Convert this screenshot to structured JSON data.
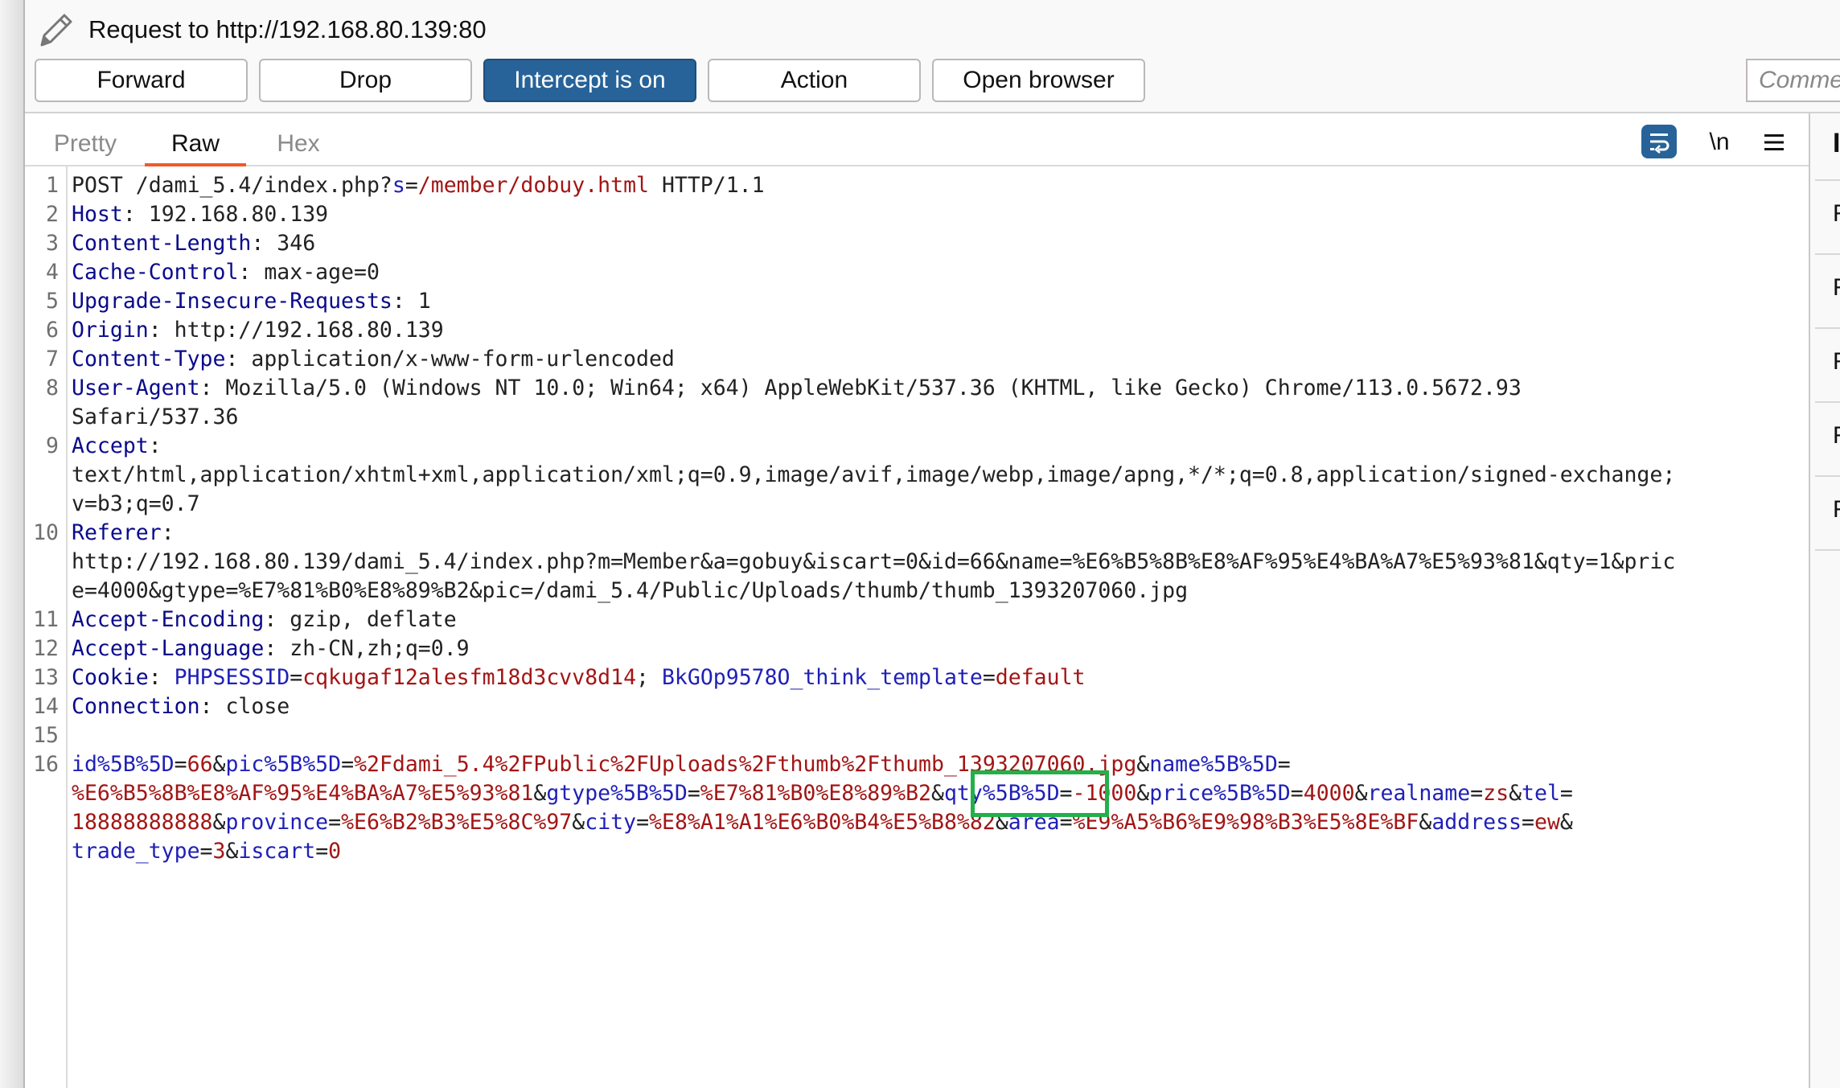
{
  "header": {
    "icon": "pencil-icon",
    "title": "Request to http://192.168.80.139:80"
  },
  "toolbar": {
    "forward_label": "Forward",
    "drop_label": "Drop",
    "intercept_label": "Intercept is on",
    "action_label": "Action",
    "open_browser_label": "Open browser",
    "comment_placeholder": "Comment"
  },
  "colors": {
    "primary_button": "#276399",
    "active_tab_underline": "#f05a28",
    "highlight_box": "#22b04a",
    "header_name": "#0a0a8c",
    "param_name": "#1f1fb8",
    "param_value": "#a31515"
  },
  "editor": {
    "tabs": [
      {
        "label": "Pretty",
        "active": false
      },
      {
        "label": "Raw",
        "active": true
      },
      {
        "label": "Hex",
        "active": false
      }
    ],
    "icons": {
      "wrap": "wrap-lines-icon",
      "newline": "\\n",
      "menu": "menu-icon"
    },
    "line_numbers": [
      "1",
      "2",
      "3",
      "4",
      "5",
      "6",
      "7",
      "8",
      "",
      "9",
      "",
      "",
      "10",
      "",
      "",
      "11",
      "12",
      "13",
      "14",
      "15",
      "16",
      "",
      "",
      ""
    ],
    "lines": [
      {
        "num": "1",
        "segments": [
          {
            "t": "POST /dami_5.4/index.php?",
            "c": "p"
          },
          {
            "t": "s",
            "c": "n"
          },
          {
            "t": "=",
            "c": "p"
          },
          {
            "t": "/member/dobuy.html",
            "c": "v"
          },
          {
            "t": " HTTP/1.1",
            "c": "p"
          }
        ]
      },
      {
        "num": "2",
        "segments": [
          {
            "t": "Host",
            "c": "k"
          },
          {
            "t": ": 192.168.80.139",
            "c": "p"
          }
        ]
      },
      {
        "num": "3",
        "segments": [
          {
            "t": "Content-Length",
            "c": "k"
          },
          {
            "t": ": 346",
            "c": "p"
          }
        ]
      },
      {
        "num": "4",
        "segments": [
          {
            "t": "Cache-Control",
            "c": "k"
          },
          {
            "t": ": max-age=0",
            "c": "p"
          }
        ]
      },
      {
        "num": "5",
        "segments": [
          {
            "t": "Upgrade-Insecure-Requests",
            "c": "k"
          },
          {
            "t": ": 1",
            "c": "p"
          }
        ]
      },
      {
        "num": "6",
        "segments": [
          {
            "t": "Origin",
            "c": "k"
          },
          {
            "t": ": http://192.168.80.139",
            "c": "p"
          }
        ]
      },
      {
        "num": "7",
        "segments": [
          {
            "t": "Content-Type",
            "c": "k"
          },
          {
            "t": ": application/x-www-form-urlencoded",
            "c": "p"
          }
        ]
      },
      {
        "num": "8",
        "segments": [
          {
            "t": "User-Agent",
            "c": "k"
          },
          {
            "t": ": Mozilla/5.0 (Windows NT 10.0; Win64; x64) AppleWebKit/537.36 (KHTML, like Gecko) Chrome/113.0.5672.93",
            "c": "p"
          }
        ]
      },
      {
        "num": "",
        "segments": [
          {
            "t": "Safari/537.36",
            "c": "p"
          }
        ]
      },
      {
        "num": "9",
        "segments": [
          {
            "t": "Accept",
            "c": "k"
          },
          {
            "t": ":",
            "c": "p"
          }
        ]
      },
      {
        "num": "",
        "segments": [
          {
            "t": "text/html,application/xhtml+xml,application/xml;q=0.9,image/avif,image/webp,image/apng,*/*;q=0.8,application/signed-exchange;",
            "c": "p"
          }
        ]
      },
      {
        "num": "",
        "segments": [
          {
            "t": "v=b3;q=0.7",
            "c": "p"
          }
        ]
      },
      {
        "num": "10",
        "segments": [
          {
            "t": "Referer",
            "c": "k"
          },
          {
            "t": ":",
            "c": "p"
          }
        ]
      },
      {
        "num": "",
        "segments": [
          {
            "t": "http://192.168.80.139/dami_5.4/index.php?m=Member&a=gobuy&iscart=0&id=66&name=%E6%B5%8B%E8%AF%95%E4%BA%A7%E5%93%81&qty=1&pric",
            "c": "p"
          }
        ]
      },
      {
        "num": "",
        "segments": [
          {
            "t": "e=4000&gtype=%E7%81%B0%E8%89%B2&pic=/dami_5.4/Public/Uploads/thumb/thumb_1393207060.jpg",
            "c": "p"
          }
        ]
      },
      {
        "num": "11",
        "segments": [
          {
            "t": "Accept-Encoding",
            "c": "k"
          },
          {
            "t": ": gzip, deflate",
            "c": "p"
          }
        ]
      },
      {
        "num": "12",
        "segments": [
          {
            "t": "Accept-Language",
            "c": "k"
          },
          {
            "t": ": zh-CN,zh;q=0.9",
            "c": "p"
          }
        ]
      },
      {
        "num": "13",
        "segments": [
          {
            "t": "Cookie",
            "c": "k"
          },
          {
            "t": ": ",
            "c": "p"
          },
          {
            "t": "PHPSESSID",
            "c": "n"
          },
          {
            "t": "=",
            "c": "p"
          },
          {
            "t": "cqkugaf12alesfm18d3cvv8d14",
            "c": "v"
          },
          {
            "t": "; ",
            "c": "p"
          },
          {
            "t": "BkGOp9578O_think_template",
            "c": "n"
          },
          {
            "t": "=",
            "c": "p"
          },
          {
            "t": "default",
            "c": "v"
          }
        ]
      },
      {
        "num": "14",
        "segments": [
          {
            "t": "Connection",
            "c": "k"
          },
          {
            "t": ": close",
            "c": "p"
          }
        ]
      },
      {
        "num": "15",
        "segments": []
      },
      {
        "num": "16",
        "segments": [
          {
            "t": "id%5B%5D",
            "c": "n"
          },
          {
            "t": "=",
            "c": "p"
          },
          {
            "t": "66",
            "c": "v"
          },
          {
            "t": "&",
            "c": "p"
          },
          {
            "t": "pic%5B%5D",
            "c": "n"
          },
          {
            "t": "=",
            "c": "p"
          },
          {
            "t": "%2Fdami_5.4%2FPublic%2FUploads%2Fthumb%2Fthumb_1393207060.jpg",
            "c": "v"
          },
          {
            "t": "&",
            "c": "p"
          },
          {
            "t": "name%5B%5D",
            "c": "n"
          },
          {
            "t": "=",
            "c": "p"
          }
        ]
      },
      {
        "num": "",
        "current": true,
        "segments": [
          {
            "t": "%E6%B5%8B%E8%AF%95%E4%BA%A7%E5%93%81",
            "c": "v"
          },
          {
            "t": "&",
            "c": "p"
          },
          {
            "t": "gtype%5B%5D",
            "c": "n"
          },
          {
            "t": "=",
            "c": "p"
          },
          {
            "t": "%E7%81%B0%E8%89%B2",
            "c": "v"
          },
          {
            "t": "&",
            "c": "p"
          },
          {
            "t": "qty%5B%5D",
            "c": "n"
          },
          {
            "t": "=",
            "c": "p"
          },
          {
            "t": "-1000",
            "c": "v"
          },
          {
            "t": "&",
            "c": "p"
          },
          {
            "t": "price%5B%5D",
            "c": "n"
          },
          {
            "t": "=",
            "c": "p"
          },
          {
            "t": "4000",
            "c": "v"
          },
          {
            "t": "&",
            "c": "p"
          },
          {
            "t": "realname",
            "c": "n"
          },
          {
            "t": "=",
            "c": "p"
          },
          {
            "t": "zs",
            "c": "v"
          },
          {
            "t": "&",
            "c": "p"
          },
          {
            "t": "tel",
            "c": "n"
          },
          {
            "t": "=",
            "c": "p"
          }
        ]
      },
      {
        "num": "",
        "segments": [
          {
            "t": "18888888888",
            "c": "v"
          },
          {
            "t": "&",
            "c": "p"
          },
          {
            "t": "province",
            "c": "n"
          },
          {
            "t": "=",
            "c": "p"
          },
          {
            "t": "%E6%B2%B3%E5%8C%97",
            "c": "v"
          },
          {
            "t": "&",
            "c": "p"
          },
          {
            "t": "city",
            "c": "n"
          },
          {
            "t": "=",
            "c": "p"
          },
          {
            "t": "%E8%A1%A1%E6%B0%B4%E5%B8%82",
            "c": "v"
          },
          {
            "t": "&",
            "c": "p"
          },
          {
            "t": "area",
            "c": "n"
          },
          {
            "t": "=",
            "c": "p"
          },
          {
            "t": "%E9%A5%B6%E9%98%B3%E5%8E%BF",
            "c": "v"
          },
          {
            "t": "&",
            "c": "p"
          },
          {
            "t": "address",
            "c": "n"
          },
          {
            "t": "=",
            "c": "p"
          },
          {
            "t": "ew",
            "c": "v"
          },
          {
            "t": "&",
            "c": "p"
          }
        ]
      },
      {
        "num": "",
        "segments": [
          {
            "t": "trade_type",
            "c": "n"
          },
          {
            "t": "=",
            "c": "p"
          },
          {
            "t": "3",
            "c": "v"
          },
          {
            "t": "&",
            "c": "p"
          },
          {
            "t": "iscart",
            "c": "n"
          },
          {
            "t": "=",
            "c": "p"
          },
          {
            "t": "0",
            "c": "v"
          }
        ]
      }
    ],
    "highlighted_param": "qty%5B%5D=-1000&"
  },
  "inspector": {
    "title_initial": "I",
    "row_initials": [
      "R",
      "R",
      "R",
      "R",
      "R"
    ]
  }
}
